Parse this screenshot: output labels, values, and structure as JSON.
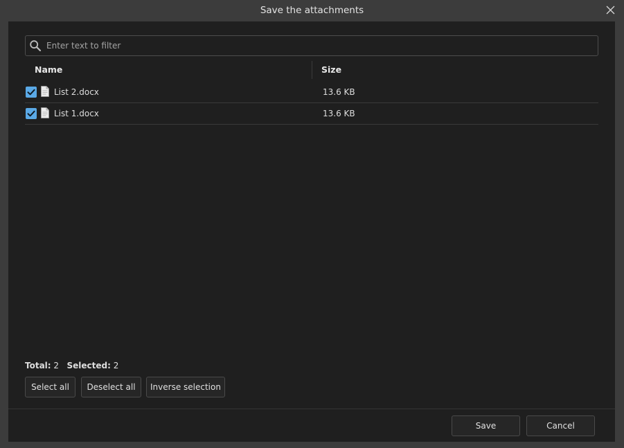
{
  "window": {
    "title": "Save the attachments"
  },
  "search": {
    "placeholder": "Enter text to filter",
    "value": ""
  },
  "table": {
    "columns": {
      "name": "Name",
      "size": "Size"
    },
    "rows": [
      {
        "checked": true,
        "icon": "document-icon",
        "name": "List 2.docx",
        "size": "13.6 KB"
      },
      {
        "checked": true,
        "icon": "document-icon",
        "name": "List 1.docx",
        "size": "13.6 KB"
      }
    ]
  },
  "summary": {
    "total_label": "Total:",
    "total_value": "2",
    "selected_label": "Selected:",
    "selected_value": "2"
  },
  "selection_buttons": {
    "select_all": "Select all",
    "deselect_all": "Deselect all",
    "inverse": "Inverse selection"
  },
  "footer": {
    "save": "Save",
    "cancel": "Cancel"
  },
  "colors": {
    "checkbox_accent": "#5aa9e6",
    "panel_background": "#1f1f1f",
    "window_background": "#3c3c3c"
  }
}
